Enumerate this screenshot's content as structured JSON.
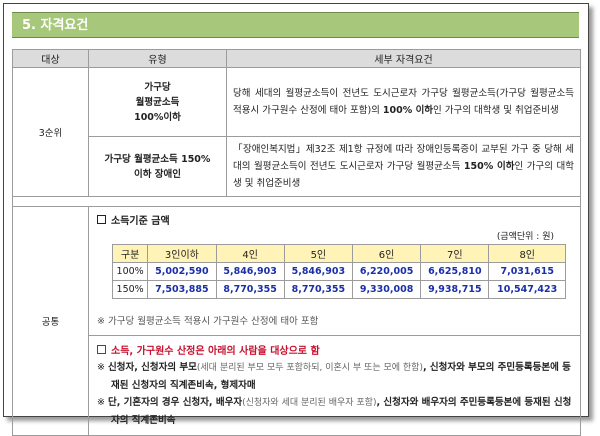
{
  "section_title": "5. 자격요건",
  "headers": {
    "target": "대상",
    "type": "유형",
    "detail": "세부 자격요건"
  },
  "rank3": {
    "target": "3순위",
    "row1": {
      "type_line1": "가구당",
      "type_line2": "월평균소득",
      "type_line3": "100%이하",
      "detail_a": "당해 세대의 월평균소득이 전년도 도시근로자 가구당 월평균소득(가구당 월평균소득 적용시 가구원수 산정에 태아 포함)의 ",
      "detail_bold": "100% 이하",
      "detail_b": "인 가구의 대학생 및 취업준비생"
    },
    "row2": {
      "type_line1": "가구당 월평균소득 150%",
      "type_line2": "이하 장애인",
      "detail_a": "「장애인복지법」제32조 제1항 규정에 따라 장애인등록증이 교부된 가구 중 당해 세대의 월평균소득이 전년도 도시근로자 가구당 월평균소득 ",
      "detail_bold": "150% 이하",
      "detail_b": "인 가구의 대학생 및 취업준비생"
    }
  },
  "common": {
    "target": "공통",
    "income_title": "소득기준 금액",
    "unit": "(금액단위 : 원)",
    "income_table": {
      "headers": [
        "구분",
        "3인이하",
        "4인",
        "5인",
        "6인",
        "7인",
        "8인"
      ],
      "rows": [
        {
          "label": "100%",
          "values": [
            "5,002,590",
            "5,846,903",
            "5,846,903",
            "6,220,005",
            "6,625,810",
            "7,031,615"
          ]
        },
        {
          "label": "150%",
          "values": [
            "7,503,885",
            "8,770,355",
            "8,770,355",
            "9,330,008",
            "9,938,715",
            "10,547,423"
          ]
        }
      ]
    },
    "income_note": "※ 가구당 월평균소득 적용시 가구원수 산정에 태아 포함",
    "household_title": "소득, 가구원수 산정은 아래의 사람을 대상으로 함",
    "line1": {
      "mark": "※",
      "bold_a": "신청자, 신청자의 부모",
      "sub_a": "(세대 분리된 부모 모두 포함하되, 이혼시 부 또는 모에 한함)",
      "bold_b": ", 신청자와 부모의 주민등록등본에 등재된 신청자의 직계존비속, 형제자매"
    },
    "line2": {
      "mark": "※",
      "bold_a": "단, 기혼자의 경우 신청자, 배우자",
      "sub_a": "(신청자와 세대 분리된 배우자 포함)",
      "bold_b": ", 신청자와 배우자의 주민등록등본에 등재된 신청자의 직계존비속"
    }
  }
}
